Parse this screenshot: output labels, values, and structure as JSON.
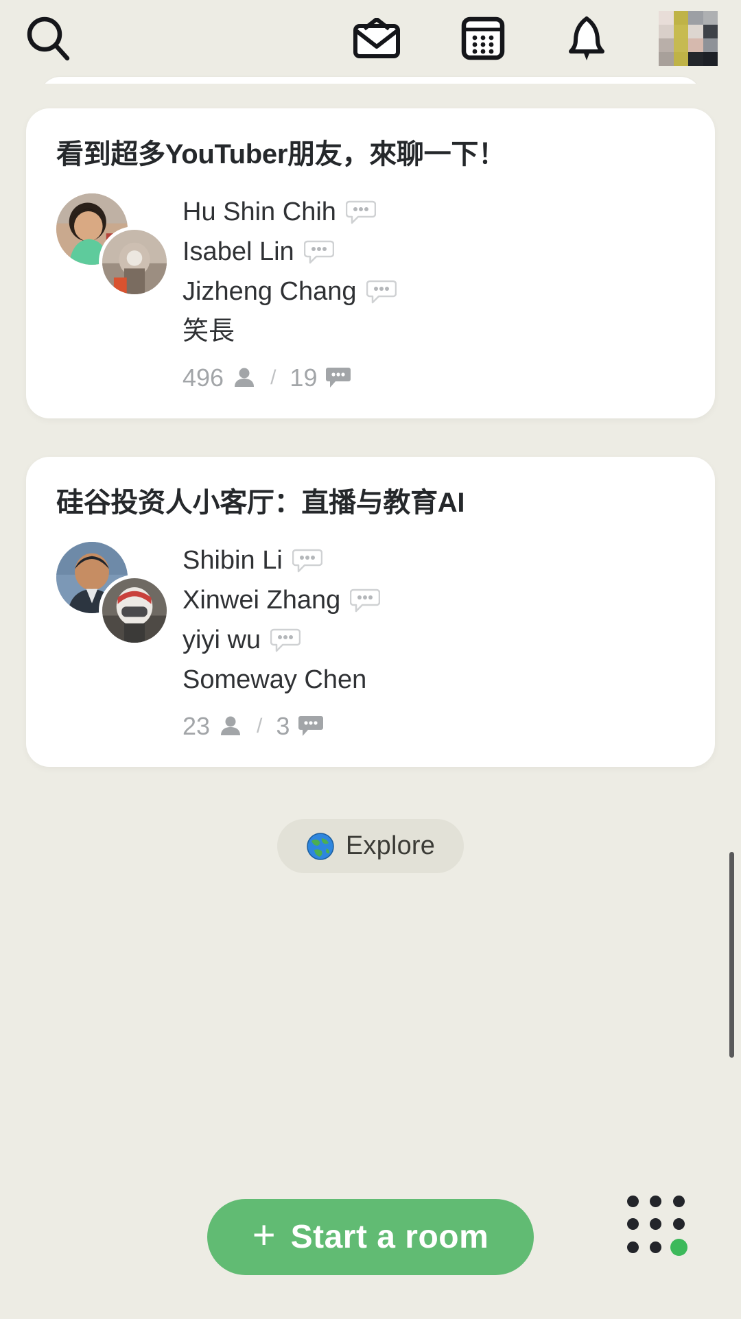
{
  "theme": {
    "page_bg": "#EDECE4",
    "card_bg": "#FFFFFF",
    "text_primary": "#25282B",
    "text_secondary": "#A2A5A8",
    "accent_green": "#61BB73",
    "dot_green": "#3CB95A",
    "pill_bg": "#E2E1D7"
  },
  "header": {
    "search_icon": "search-icon",
    "invite_icon": "envelope-icon",
    "calendar_icon": "calendar-icon",
    "bell_icon": "bell-icon",
    "avatar": "profile-avatar"
  },
  "rooms": [
    {
      "title": "看到超多YouTuber朋友，來聊一下！",
      "members": [
        {
          "name": "Hu Shin Chih",
          "speaking": true
        },
        {
          "name": "Isabel Lin",
          "speaking": true
        },
        {
          "name": "Jizheng Chang",
          "speaking": true
        },
        {
          "name": "笑長",
          "speaking": false
        }
      ],
      "people_count": "496",
      "separator": "/",
      "speaker_count": "19",
      "people_icon": "person-icon",
      "speaker_icon": "chat-bubble-icon"
    },
    {
      "title": "硅谷投资人小客厅：直播与教育AI",
      "members": [
        {
          "name": "Shibin Li",
          "speaking": true
        },
        {
          "name": "Xinwei Zhang",
          "speaking": true
        },
        {
          "name": "yiyi wu",
          "speaking": true
        },
        {
          "name": "Someway Chen",
          "speaking": false
        }
      ],
      "people_count": "23",
      "separator": "/",
      "speaker_count": "3",
      "people_icon": "person-icon",
      "speaker_icon": "chat-bubble-icon"
    }
  ],
  "explore": {
    "label": "Explore",
    "icon": "globe-icon"
  },
  "bottom": {
    "start_room_plus": "+",
    "start_room_label": "Start a room",
    "grid_icon": "dots-grid-icon"
  }
}
